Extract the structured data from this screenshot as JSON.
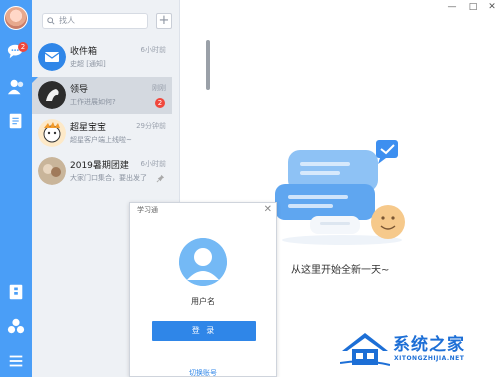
{
  "nav": {
    "badge": "2"
  },
  "search": {
    "placeholder": "找人",
    "add_label": "+"
  },
  "conversations": [
    {
      "name": "收件箱",
      "preview": "史超 [通知]",
      "time": "6小时前",
      "badge": ""
    },
    {
      "name": "领导",
      "preview": "工作进展如何?",
      "time": "刚刚",
      "badge": "2"
    },
    {
      "name": "超星宝宝",
      "preview": "超星客户端上线啦~",
      "time": "29分钟前",
      "badge": ""
    },
    {
      "name": "2019暑期团建",
      "preview": "大家门口集合，要出发了",
      "time": "6小时前",
      "badge": ""
    }
  ],
  "window": {
    "minimize": "—",
    "maximize": "□",
    "close": "✕"
  },
  "empty_state": {
    "text": "从这里开始全新一天~"
  },
  "login": {
    "title": "学习通",
    "close": "✕",
    "username": "用户名",
    "button": "登 录",
    "switch": "切换账号"
  },
  "watermark": {
    "title": "系统之家",
    "url": "XITONGZHIJIA.NET"
  },
  "colors": {
    "nav": "#4a9ef7",
    "accent": "#2f86e8",
    "badge": "#f0473c"
  },
  "icons": [
    "chat-icon",
    "contacts-icon",
    "notes-icon",
    "folder-icon",
    "apps-icon",
    "menu-icon",
    "search-icon",
    "pin-icon"
  ]
}
